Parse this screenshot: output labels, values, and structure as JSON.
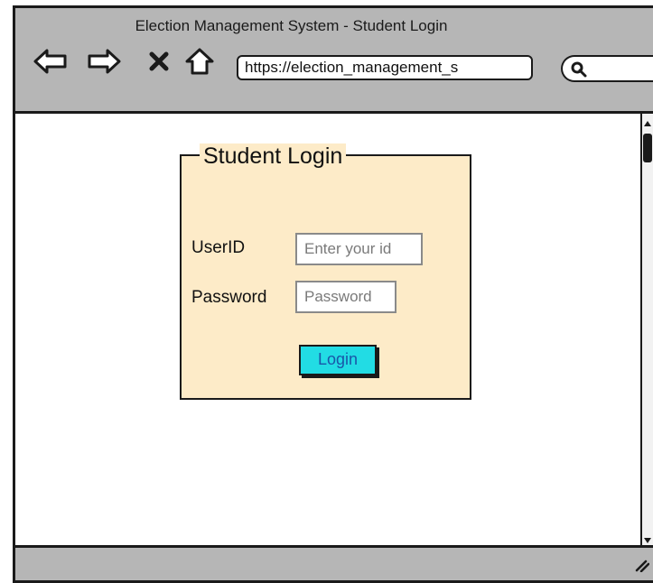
{
  "window": {
    "title": "Election Management System - Student Login",
    "url": "https://election_management_s"
  },
  "toolbar": {
    "icons": [
      "back-arrow-icon",
      "forward-arrow-icon",
      "close-x-icon",
      "home-icon",
      "search-icon"
    ]
  },
  "login": {
    "heading": "Student Login",
    "userid_label": "UserID",
    "userid_placeholder": "Enter your id",
    "password_label": "Password",
    "password_placeholder": "Password",
    "login_button": "Login"
  },
  "colors": {
    "panel_background": "#fdebc8",
    "button_background": "#22dce4",
    "chrome_gray": "#b6b6b6"
  }
}
